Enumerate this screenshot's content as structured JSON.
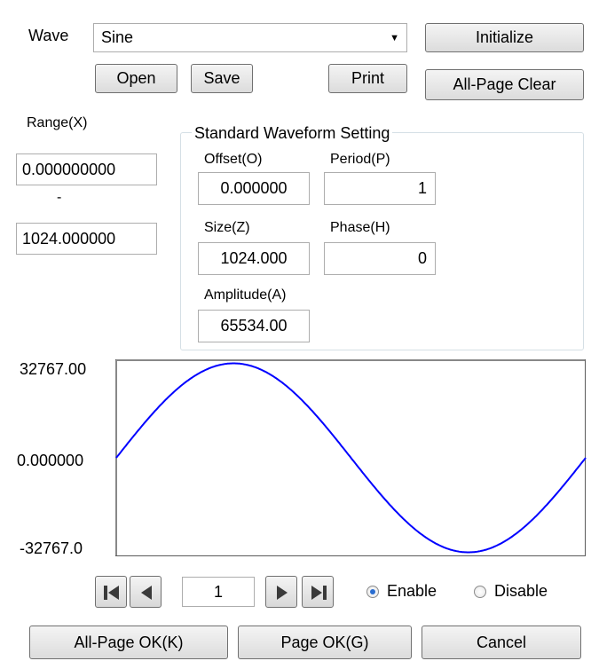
{
  "wave": {
    "label": "Wave",
    "selected": "Sine"
  },
  "toolbar": {
    "initialize": "Initialize",
    "open": "Open",
    "save": "Save",
    "print": "Print",
    "all_page_clear": "All-Page Clear"
  },
  "range": {
    "label": "Range(X)",
    "from": "0.000000000",
    "separator": "-",
    "to": "1024.000000"
  },
  "standard": {
    "title": "Standard Waveform Setting",
    "offset": {
      "label": "Offset(O)",
      "value": "0.000000"
    },
    "period": {
      "label": "Period(P)",
      "value": "1"
    },
    "size": {
      "label": "Size(Z)",
      "value": "1024.000"
    },
    "phase": {
      "label": "Phase(H)",
      "value": "0"
    },
    "amplitude": {
      "label": "Amplitude(A)",
      "value": "65534.00"
    }
  },
  "chart_labels": {
    "ymax": "32767.00",
    "ymid": "0.000000",
    "ymin": "-32767.0"
  },
  "chart_data": {
    "type": "line",
    "series": [
      {
        "function": "sine",
        "amplitude": 32767,
        "periods": 1,
        "phase": 0,
        "offset": 0,
        "color": "#0000ff"
      }
    ],
    "xlim": [
      0,
      1024
    ],
    "ylim": [
      -32767,
      32767
    ],
    "ytick_labels": [
      "32767.00",
      "0.000000",
      "-32767.0"
    ],
    "grid": false
  },
  "nav": {
    "page": "1"
  },
  "mode": {
    "enable": "Enable",
    "disable": "Disable",
    "selected": "enable"
  },
  "footer": {
    "all_page_ok": "All-Page OK(K)",
    "page_ok": "Page OK(G)",
    "cancel": "Cancel"
  },
  "colors": {
    "wave": "#0000ff",
    "radio_checked": "#2a6dd0"
  }
}
